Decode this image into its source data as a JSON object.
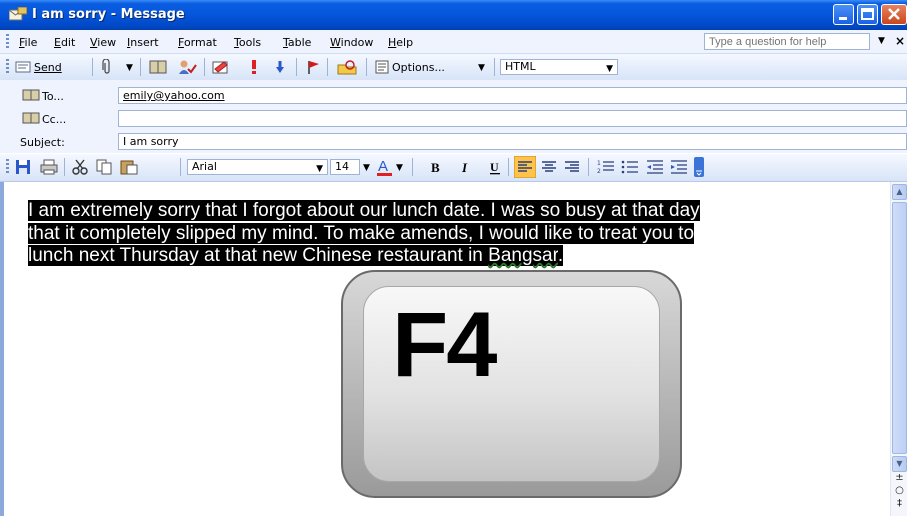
{
  "window": {
    "title": "I am sorry - Message"
  },
  "menu": {
    "items": [
      "File",
      "Edit",
      "View",
      "Insert",
      "Format",
      "Tools",
      "Table",
      "Window",
      "Help"
    ],
    "help_placeholder": "Type a question for help"
  },
  "toolbar": {
    "send_label": "Send",
    "options_label": "Options...",
    "format_value": "HTML"
  },
  "header": {
    "to_label": "To...",
    "to_value": "emily@yahoo.com",
    "cc_label": "Cc...",
    "cc_value": "",
    "subject_label": "Subject:",
    "subject_value": "I am sorry"
  },
  "formatting": {
    "font_name": "Arial",
    "font_size": "14"
  },
  "message": {
    "line1": "I am extremely sorry that I forgot about our lunch date. I was so busy at that day",
    "line2": "that it completely slipped my mind. To make amends, I would like to treat you to",
    "line3a": "lunch next Thursday at that new Chinese restaurant in ",
    "line3b": "Bangsar",
    "line3c": "."
  },
  "image": {
    "key_label": "F4"
  },
  "colors": {
    "titlebar": "#0556dc",
    "selection_bg": "#000000",
    "selection_fg": "#ffffff",
    "align_active": "#ffc24a"
  },
  "icons": [
    "app-envelope-icon",
    "minimize-icon",
    "maximize-icon",
    "close-icon",
    "send-icon",
    "attach-icon",
    "address-book-icon",
    "check-names-icon",
    "signature-icon",
    "importance-high-icon",
    "importance-low-icon",
    "flag-icon",
    "permission-icon",
    "options-icon",
    "save-icon",
    "print-icon",
    "cut-icon",
    "copy-icon",
    "paste-icon",
    "bold-icon",
    "italic-icon",
    "underline-icon",
    "align-left-icon",
    "align-center-icon",
    "align-right-icon",
    "numbering-icon",
    "bullets-icon",
    "decrease-indent-icon",
    "increase-indent-icon",
    "scroll-up-icon",
    "scroll-down-icon"
  ]
}
